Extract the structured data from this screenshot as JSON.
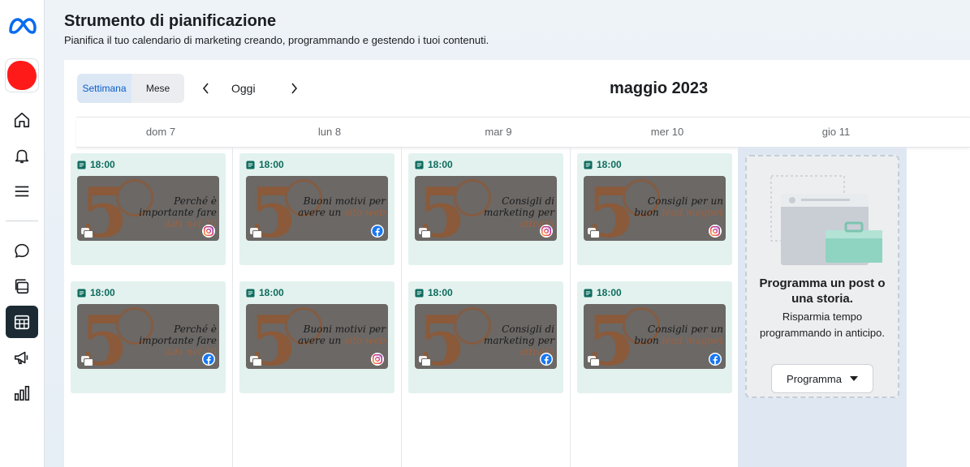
{
  "header": {
    "title": "Strumento di pianificazione",
    "subtitle": "Pianifica il tuo calendario di marketing creando, programmando e gestendo i tuoi contenuti."
  },
  "sidebar": {
    "logo_icon": "meta-logo-icon",
    "items": [
      {
        "icon": "home-icon",
        "active": false
      },
      {
        "icon": "bell-icon",
        "active": false
      },
      {
        "icon": "menu-icon",
        "active": false
      },
      {
        "icon": "chat-icon",
        "active": false
      },
      {
        "icon": "content-stack-icon",
        "active": false
      },
      {
        "icon": "calendar-icon",
        "active": true
      },
      {
        "icon": "megaphone-icon",
        "active": false
      },
      {
        "icon": "bar-chart-icon",
        "active": false
      }
    ]
  },
  "toolbar": {
    "view_week": "Settimana",
    "view_month": "Mese",
    "today": "Oggi",
    "month_label": "maggio 2023"
  },
  "days": [
    "dom 7",
    "lun 8",
    "mar 9",
    "mer 10",
    "gio 11"
  ],
  "posts": [
    {
      "time": "18:00",
      "platform": "instagram",
      "lines": [
        "Perché è",
        "importante fare"
      ],
      "highlight": "Ads nel 20"
    },
    {
      "time": "18:00",
      "platform": "facebook",
      "lines": [
        "Buoni motivi per",
        "avere un"
      ],
      "highlight": "sito web"
    },
    {
      "time": "18:00",
      "platform": "instagram",
      "lines": [
        "Consigli di",
        "marketing per"
      ],
      "highlight": "attività"
    },
    {
      "time": "18:00",
      "platform": "instagram",
      "lines": [
        "Consigli per un",
        "buon"
      ],
      "highlight": "lead magnet"
    },
    {
      "time": "18:00",
      "platform": "facebook",
      "lines": [
        "Perché è",
        "importante fare"
      ],
      "highlight": "Ads nel 20"
    },
    {
      "time": "18:00",
      "platform": "instagram",
      "lines": [
        "Buoni motivi per",
        "avere un"
      ],
      "highlight": "sito web"
    },
    {
      "time": "18:00",
      "platform": "facebook",
      "lines": [
        "Consigli di",
        "marketing per"
      ],
      "highlight": "attività"
    },
    {
      "time": "18:00",
      "platform": "facebook",
      "lines": [
        "Consigli per un",
        "buon"
      ],
      "highlight": "lead magnet"
    }
  ],
  "promo": {
    "title": "Programma un post o una storia.",
    "description": "Risparmia tempo programmando in anticipo.",
    "button": "Programma"
  },
  "colors": {
    "accent": "#0a5cc7",
    "card_bg": "#e3f2ee",
    "time_text": "#0d6b5e",
    "sidebar_active": "#1c2b33"
  }
}
